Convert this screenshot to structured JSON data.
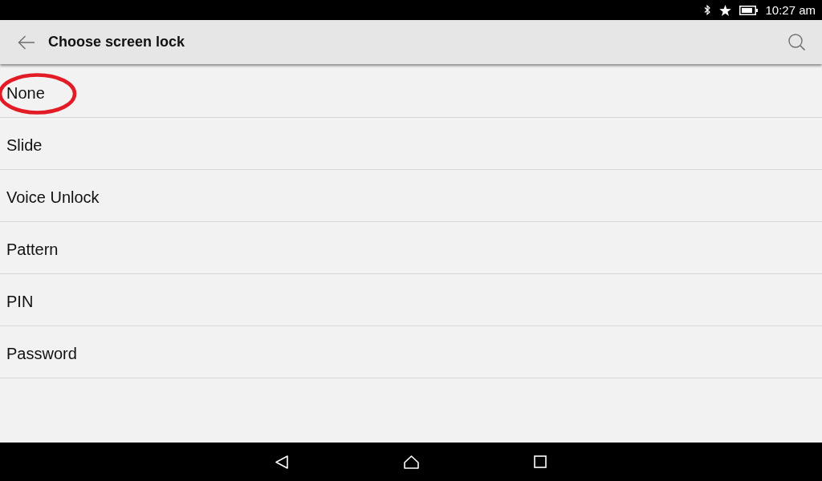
{
  "status_bar": {
    "time": "10:27 am"
  },
  "app_bar": {
    "title": "Choose screen lock"
  },
  "options": [
    {
      "label": "None",
      "circled": true
    },
    {
      "label": "Slide",
      "circled": false
    },
    {
      "label": "Voice Unlock",
      "circled": false
    },
    {
      "label": "Pattern",
      "circled": false
    },
    {
      "label": "PIN",
      "circled": false
    },
    {
      "label": "Password",
      "circled": false
    }
  ]
}
